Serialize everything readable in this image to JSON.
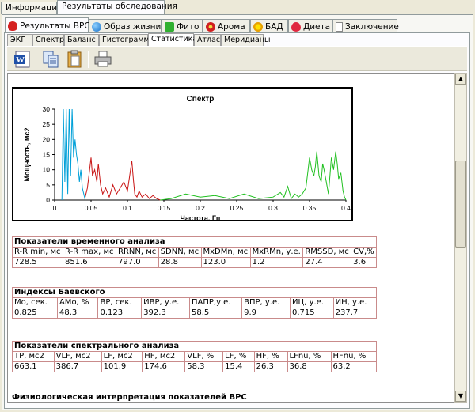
{
  "tabs_top": [
    {
      "label": "Информация"
    },
    {
      "label": "Результаты обследования"
    }
  ],
  "tabs_main": [
    {
      "label": "Результаты ВРС",
      "icon": "heart-icon"
    },
    {
      "label": "Образ жизни",
      "icon": "globe-icon"
    },
    {
      "label": "Фито",
      "icon": "star-icon"
    },
    {
      "label": "Арома",
      "icon": "flower-icon"
    },
    {
      "label": "БАД",
      "icon": "sun-icon"
    },
    {
      "label": "Диета",
      "icon": "strawberry-icon"
    },
    {
      "label": "Заключение",
      "icon": "document-icon"
    }
  ],
  "tabs_sub": [
    "ЭКГ",
    "Спектр",
    "Баланс",
    "Гистограмма",
    "Статистика",
    "Атлас",
    "Меридианы"
  ],
  "active_sub_tab": "Статистика",
  "toolbar": [
    "word-icon",
    "copy-icon",
    "paste-icon",
    "print-icon"
  ],
  "chart_data": {
    "type": "line",
    "title": "Спектр",
    "xlabel": "Частота, Гц",
    "ylabel": "Мощность, мс2",
    "xlim": [
      0,
      0.4
    ],
    "ylim": [
      0,
      30
    ],
    "xticks": [
      "0",
      "0.05",
      "0.1",
      "0.15",
      "0.2",
      "0.25",
      "0.3",
      "0.35",
      "0.4"
    ],
    "yticks": [
      "0",
      "5",
      "10",
      "15",
      "20",
      "25",
      "30"
    ],
    "series": [
      {
        "color": "#00a0d8",
        "x": [
          0.01,
          0.012,
          0.014,
          0.016,
          0.018,
          0.02,
          0.022,
          0.024,
          0.026,
          0.028,
          0.03,
          0.032,
          0.034,
          0.036,
          0.038,
          0.04,
          0.042
        ],
        "y": [
          0,
          32,
          6,
          32,
          2,
          30,
          8,
          30,
          14,
          20,
          15,
          12,
          6,
          10,
          4,
          2,
          0
        ]
      },
      {
        "color": "#c81414",
        "x": [
          0.042,
          0.045,
          0.048,
          0.05,
          0.052,
          0.055,
          0.058,
          0.06,
          0.063,
          0.066,
          0.07,
          0.075,
          0.08,
          0.085,
          0.09,
          0.095,
          0.1,
          0.103,
          0.106,
          0.108,
          0.11,
          0.113,
          0.116,
          0.12,
          0.125,
          0.13,
          0.135,
          0.14,
          0.145
        ],
        "y": [
          1,
          4,
          10,
          14,
          8,
          10,
          6,
          12,
          5,
          2,
          4,
          1,
          5,
          2,
          4,
          6,
          3,
          8,
          13,
          7,
          2,
          1,
          3,
          1,
          2,
          0.5,
          1.5,
          0.5,
          0
        ]
      },
      {
        "color": "#20c020",
        "x": [
          0.145,
          0.16,
          0.18,
          0.2,
          0.22,
          0.24,
          0.26,
          0.28,
          0.3,
          0.31,
          0.315,
          0.32,
          0.325,
          0.33,
          0.335,
          0.34,
          0.345,
          0.348,
          0.35,
          0.353,
          0.356,
          0.358,
          0.36,
          0.363,
          0.366,
          0.368,
          0.37,
          0.373,
          0.376,
          0.378,
          0.38,
          0.383,
          0.386,
          0.388,
          0.39,
          0.393,
          0.396,
          0.398,
          0.4
        ],
        "y": [
          0,
          0.5,
          2,
          1,
          1.5,
          0.5,
          2,
          0.5,
          1,
          2.5,
          1,
          4.5,
          0.5,
          2,
          1,
          2,
          4,
          10,
          14,
          10,
          8,
          11,
          16,
          8,
          6,
          12,
          10,
          6,
          2,
          8,
          14,
          10,
          16,
          12,
          7,
          9,
          3,
          1,
          0
        ]
      }
    ]
  },
  "time_analysis": {
    "title": "Показатели временного анализа",
    "headers": [
      "R-R min, мс",
      "R-R max, мс",
      "RRNN, мс",
      "SDNN, мс",
      "MxDMn, мс",
      "MxRMn, у.е.",
      "RMSSD, мс",
      "CV,%"
    ],
    "values": [
      "728.5",
      "851.6",
      "797.0",
      "28.8",
      "123.0",
      "1.2",
      "27.4",
      "3.6"
    ]
  },
  "baevsky": {
    "title": "Индексы Баевского",
    "headers": [
      "Mo, сек.",
      "AMo, %",
      "ВР, сек.",
      "ИВР, у.е.",
      "ПАПР,у.е.",
      "ВПР, у.е.",
      "ИЦ, у.е.",
      "ИН, у.е."
    ],
    "values": [
      "0.825",
      "48.3",
      "0.123",
      "392.3",
      "58.5",
      "9.9",
      "0.715",
      "237.7"
    ]
  },
  "spectral": {
    "title": "Показатели спектрального анализа",
    "headers": [
      "TP, мс2",
      "VLF, мс2",
      "LF, мс2",
      "HF, мс2",
      "VLF, %",
      "LF, %",
      "HF, %",
      "LFnu, %",
      "HFnu, %"
    ],
    "values": [
      "663.1",
      "386.7",
      "101.9",
      "174.6",
      "58.3",
      "15.4",
      "26.3",
      "36.8",
      "63.2"
    ]
  },
  "next_section": "Физиологическая интерпретация показателей ВРС",
  "scroll_up": "▲",
  "scroll_down": "▼"
}
